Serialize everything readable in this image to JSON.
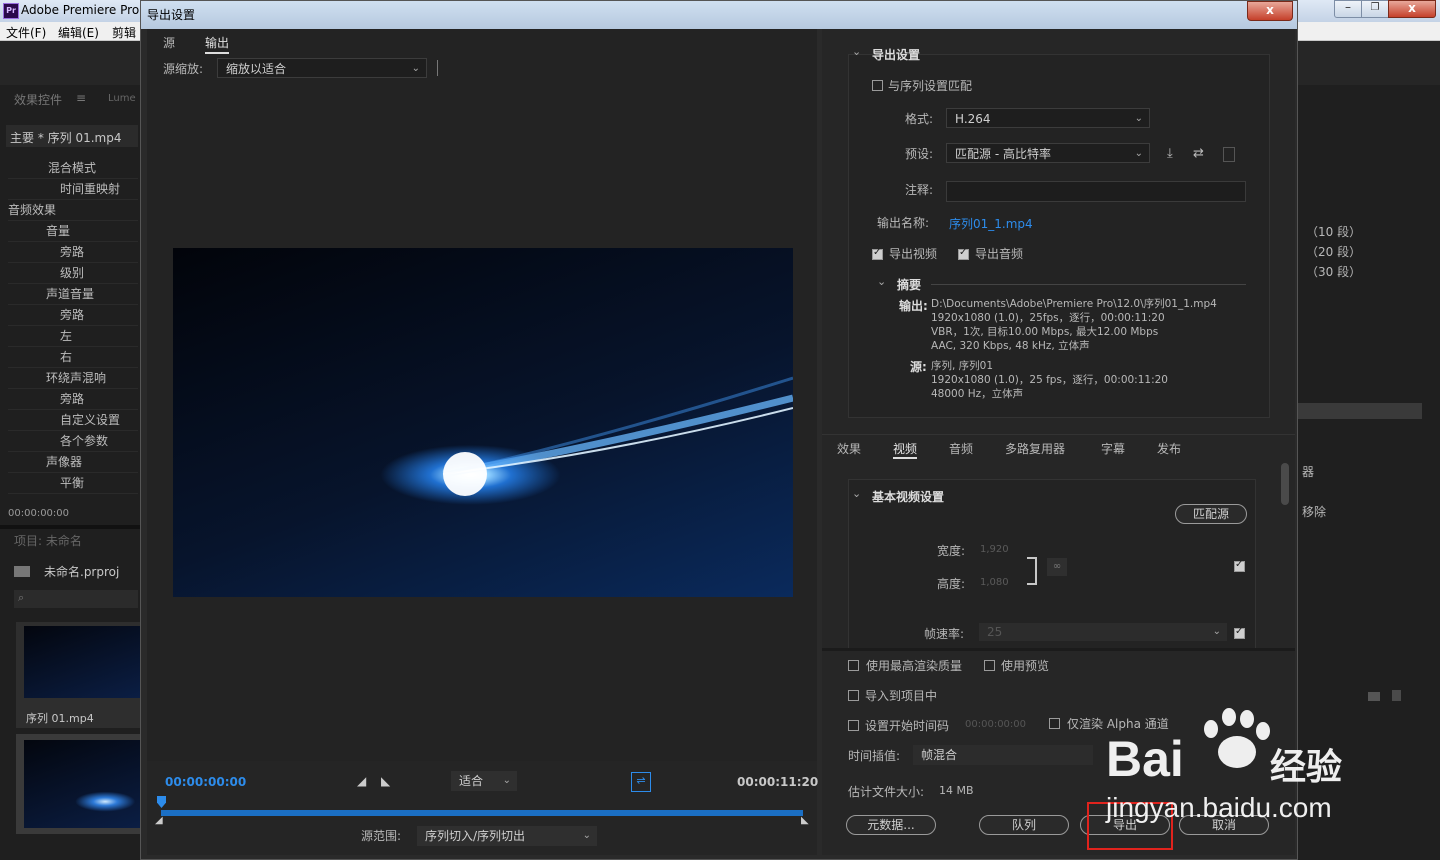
{
  "app": {
    "title": "Adobe Premiere Pro",
    "menu": [
      "文件(F)",
      "编辑(E)",
      "剪辑"
    ]
  },
  "left_panel": {
    "tab_effects": "效果控件",
    "tab_lumetri": "Lume",
    "clip_title": "主要 * 序列 01.mp4",
    "rows": [
      "混合模式",
      "时间重映射",
      "音频效果",
      "音量",
      "旁路",
      "级别",
      "声道音量",
      "旁路",
      "左",
      "右",
      "环绕声混响",
      "旁路",
      "自定义设置",
      "各个参数",
      "声像器",
      "平衡"
    ],
    "timecode": "00:00:00:00",
    "project_title": "项目: 未命名",
    "project_file": "未命名.prproj",
    "thumb_label": "序列 01.mp4"
  },
  "right_panel": {
    "items": [
      "（10 段）",
      "（20 段）",
      "（30 段）",
      "器",
      "移除"
    ]
  },
  "dialog": {
    "title": "导出设置",
    "close": "x",
    "tabs": [
      "源",
      "输出"
    ],
    "source_scale_label": "源缩放:",
    "source_scale_value": "缩放以适合",
    "timecode_start": "00:00:00:00",
    "timecode_end": "00:00:11:20",
    "fit_value": "适合",
    "source_range_label": "源范围:",
    "source_range_value": "序列切入/序列切出"
  },
  "export_settings": {
    "section_title": "导出设置",
    "match_sequence": "与序列设置匹配",
    "format_label": "格式:",
    "format_value": "H.264",
    "preset_label": "预设:",
    "preset_value": "匹配源 - 高比特率",
    "comment_label": "注释:",
    "output_name_label": "输出名称:",
    "output_name_value": "序列01_1.mp4",
    "export_video": "导出视频",
    "export_audio": "导出音频",
    "summary_title": "摘要",
    "output_label": "输出:",
    "output_lines": [
      "D:\\Documents\\Adobe\\Premiere Pro\\12.0\\序列01_1.mp4",
      "1920x1080 (1.0)，25fps，逐行，00:00:11:20",
      "VBR，1次, 目标10.00 Mbps, 最大12.00 Mbps",
      "AAC, 320 Kbps, 48 kHz, 立体声"
    ],
    "source_label": "源:",
    "source_lines": [
      "序列, 序列01",
      "1920x1080 (1.0)，25 fps，逐行，00:00:11:20",
      "48000 Hz，立体声"
    ]
  },
  "settings_tabs": [
    "效果",
    "视频",
    "音频",
    "多路复用器",
    "字幕",
    "发布"
  ],
  "video_settings": {
    "section_title": "基本视频设置",
    "match_source": "匹配源",
    "width_label": "宽度:",
    "width_value": "1,920",
    "height_label": "高度:",
    "height_value": "1,080",
    "framerate_label": "帧速率:",
    "framerate_value": "25"
  },
  "bottom_options": {
    "max_render_quality": "使用最高渲染质量",
    "use_previews": "使用预览",
    "import_into_project": "导入到项目中",
    "set_start_timecode": "设置开始时间码",
    "start_timecode_value": "00:00:00:00",
    "render_alpha_only": "仅渲染 Alpha 通道",
    "time_interpolation_label": "时间插值:",
    "time_interpolation_value": "帧混合",
    "file_size_label": "估计文件大小:",
    "file_size_value": "14 MB",
    "metadata_button": "元数据...",
    "queue_button": "队列",
    "export_button": "导出",
    "cancel_button": "取消"
  },
  "watermark": {
    "brand": "Bai",
    "brand_cn": "经验",
    "url": "jingyan.baidu.com"
  },
  "colors": {
    "accent_blue": "#2d8ceb",
    "highlight_red": "#e0231d"
  }
}
